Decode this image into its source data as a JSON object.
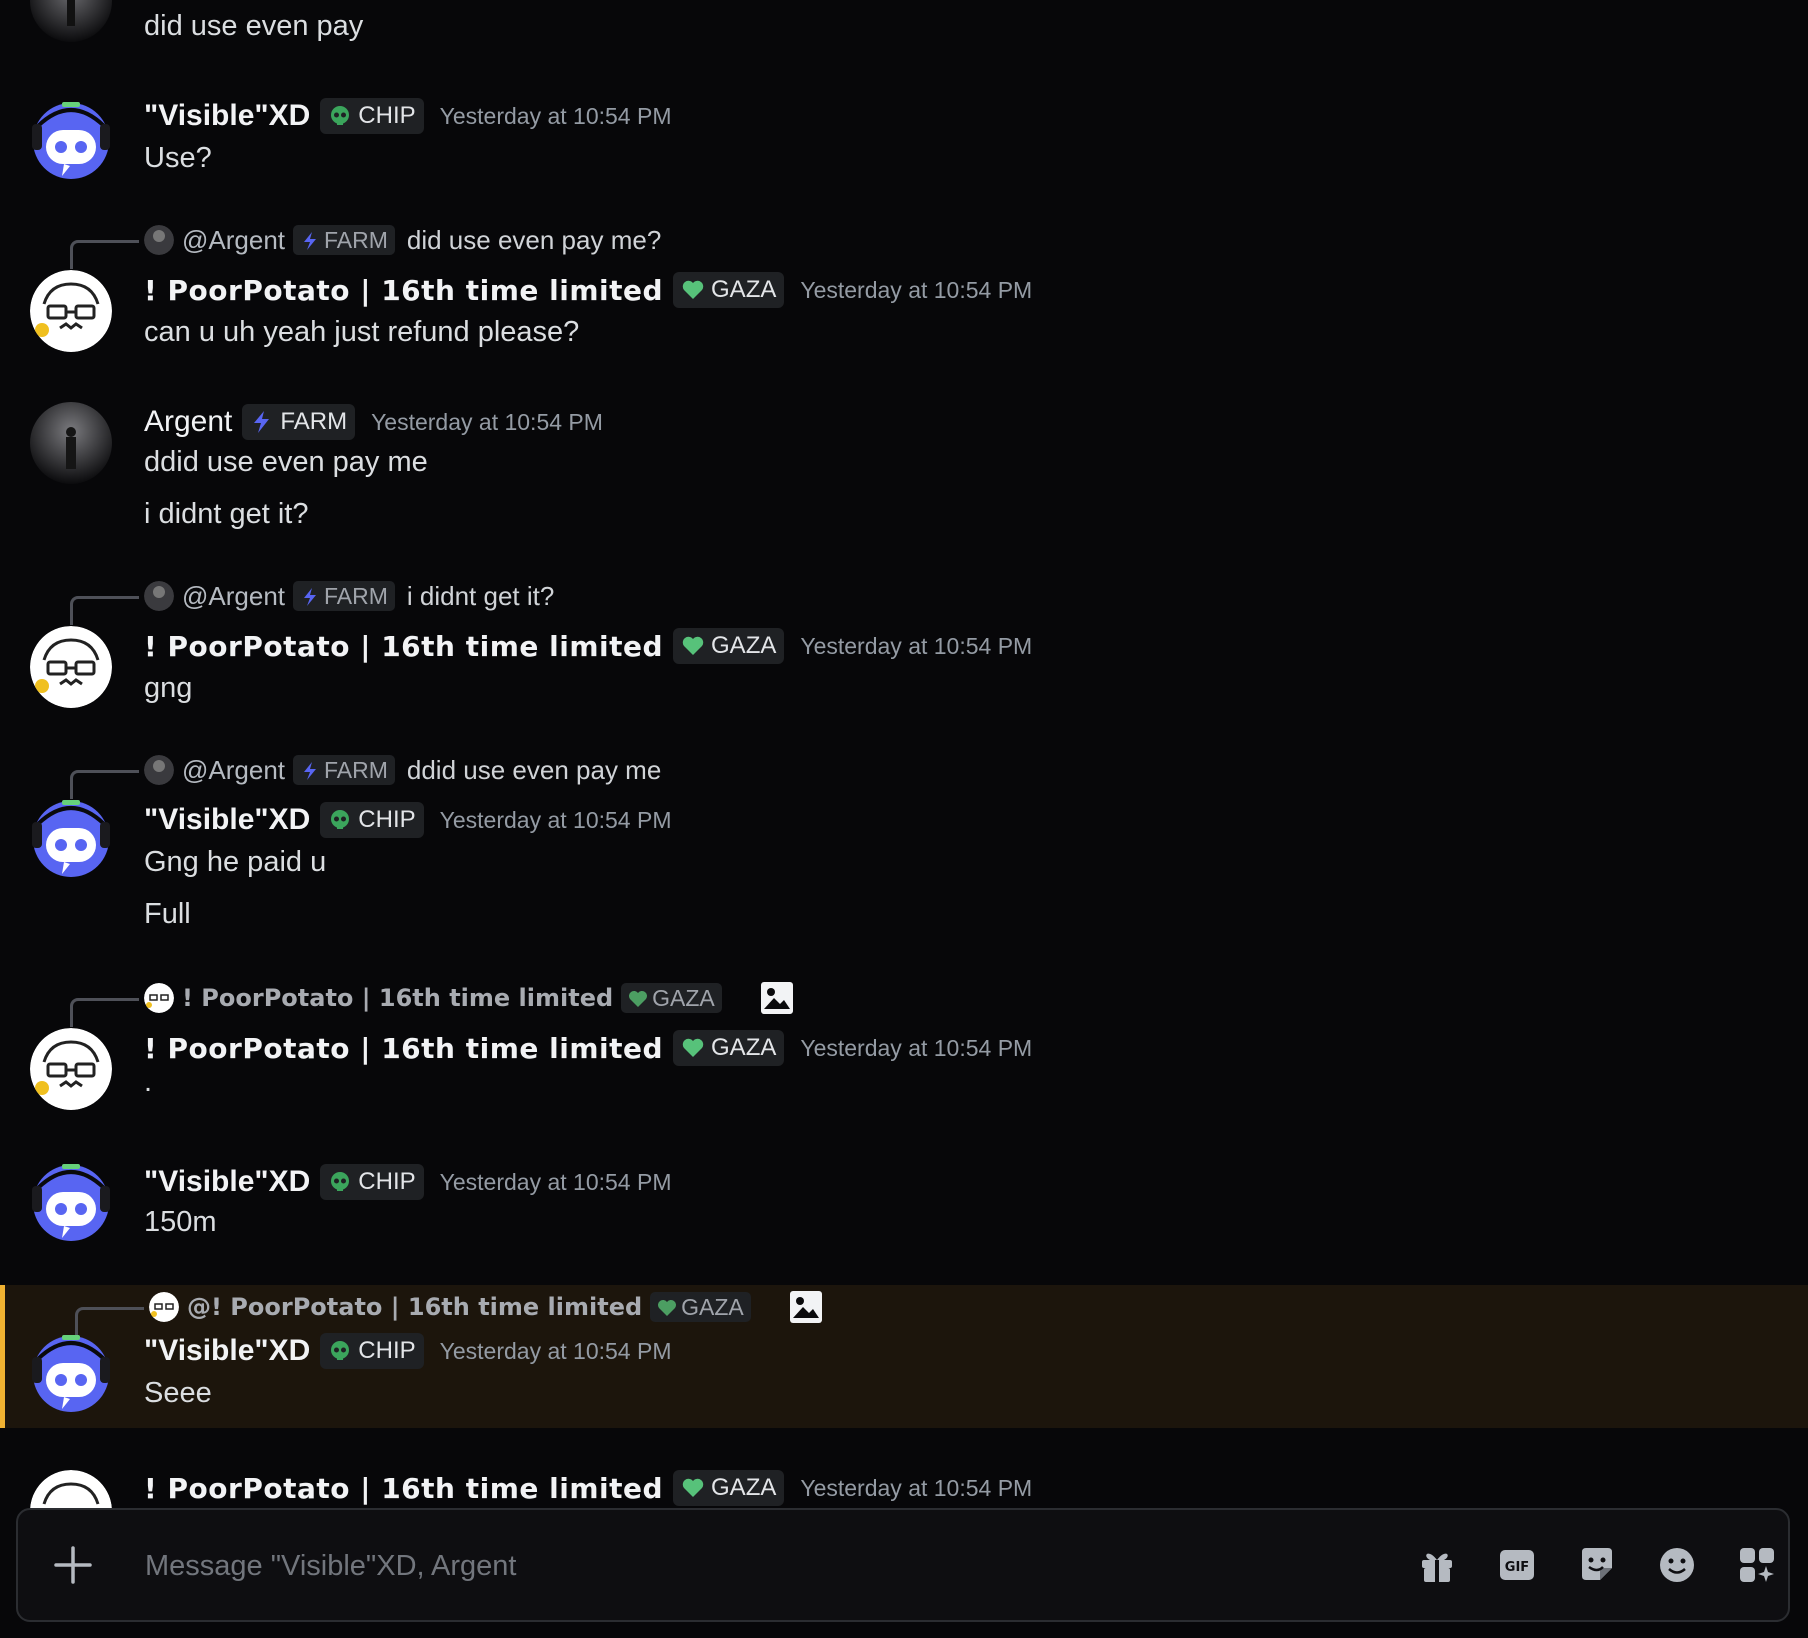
{
  "users": {
    "visible": {
      "name": "\"Visible\"XD",
      "tag": "CHIP"
    },
    "poor": {
      "name": "! PoorPotato | 16th time limited",
      "tag": "GAZA",
      "reply_name": "! PoorPotato | 16th time limited",
      "mention_name": "@! PoorPotato | 16th time limited"
    },
    "argent": {
      "name": "Argent",
      "tag": "FARM",
      "mention": "@Argent"
    }
  },
  "timestamp": "Yesterday at 10:54 PM",
  "messages": {
    "m0": {
      "text": "did use  even pay"
    },
    "m1": {
      "text": "Use?"
    },
    "m2": {
      "reply_text": "did use even pay me?",
      "text": "can u uh yeah just refund please?"
    },
    "m3": {
      "line1": "ddid use even pay me",
      "line2": "i didnt get it?"
    },
    "m4": {
      "reply_text": "i didnt get it?",
      "text": "gng"
    },
    "m5": {
      "reply_text": "ddid use even pay me",
      "line1": "Gng he paid u",
      "line2": "Full"
    },
    "m6": {
      "text": "."
    },
    "m7": {
      "text": "150m"
    },
    "m8": {
      "text": "Seee"
    }
  },
  "composer": {
    "placeholder": "Message \"Visible\"XD, Argent",
    "tools": [
      "gift-icon",
      "gif-icon",
      "sticker-icon",
      "emoji-icon",
      "apps-icon"
    ]
  },
  "colors": {
    "background": "#070709",
    "highlight_bg": "#1c150c",
    "highlight_border": "#f0b232",
    "timestamp": "#949ba4"
  }
}
